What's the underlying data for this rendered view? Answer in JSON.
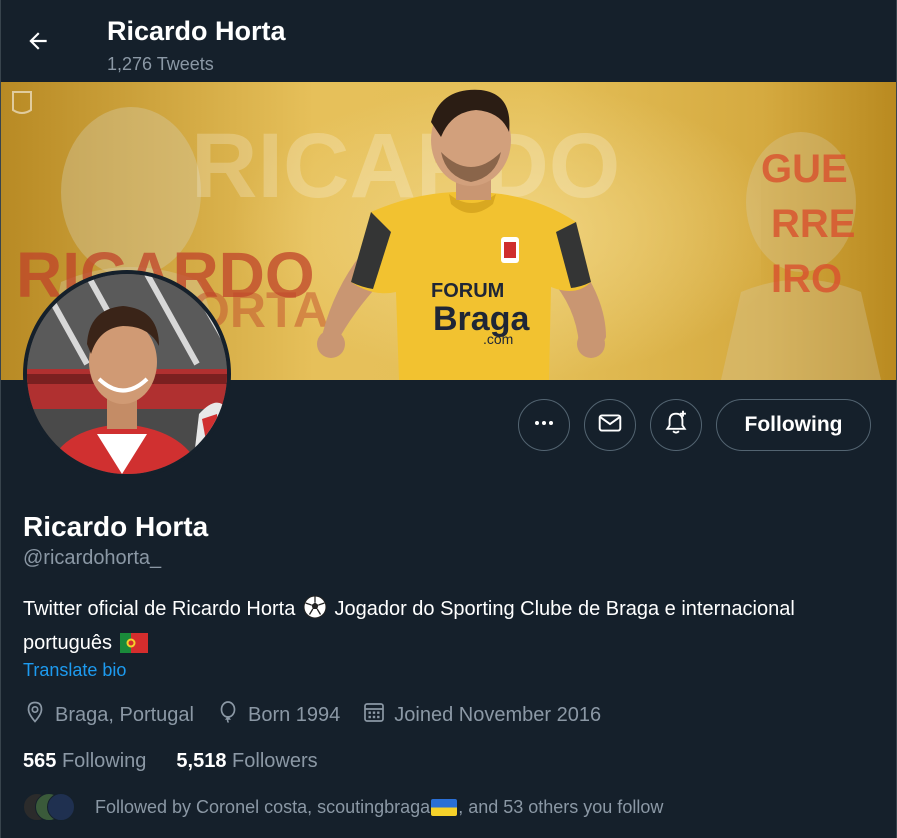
{
  "header": {
    "name": "Ricardo Horta",
    "tweet_count": "1,276 Tweets",
    "back_icon": "arrow-left-icon"
  },
  "banner": {
    "bg_text_left": "RICARDO",
    "bg_text_left2": "RICARDO",
    "bg_text_left3": "ORTA",
    "bg_text_right": "GUE RRE IRO",
    "shirt_sponsor_top": "FORUM",
    "shirt_sponsor": "Braga",
    "shirt_sponsor_tld": ".com",
    "colors": {
      "gold": "#e2bd55",
      "shirt": "#f2c230",
      "accent_red": "#d2452a"
    }
  },
  "actions": {
    "more_icon": "more-dots-icon",
    "message_icon": "envelope-icon",
    "notify_icon": "bell-plus-icon",
    "following_label": "Following"
  },
  "profile": {
    "name": "Ricardo Horta",
    "handle": "@ricardohorta_",
    "bio_part1": "Twitter oficial de Ricardo Horta",
    "bio_part2": "Jogador do Sporting Clube de Braga e internacional português",
    "translate_label": "Translate bio",
    "location": "Braga, Portugal",
    "born": "Born 1994",
    "joined": "Joined November 2016"
  },
  "stats": {
    "following_count": "565",
    "following_label": "Following",
    "followers_count": "5,518",
    "followers_label": "Followers"
  },
  "followed_by": {
    "text_before": "Followed by Coronel costa, scoutingbraga",
    "text_after": ", and 53 others you follow"
  },
  "colors": {
    "background": "#15202b",
    "secondary_text": "#8b98a5",
    "link": "#1d9bf0",
    "border": "#536471"
  }
}
